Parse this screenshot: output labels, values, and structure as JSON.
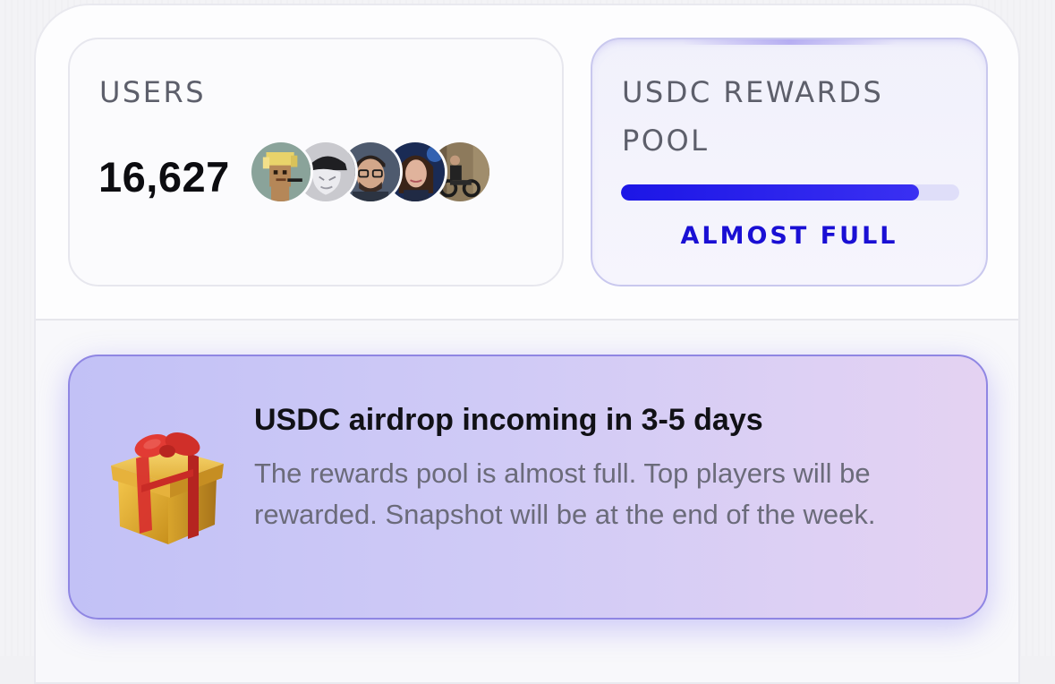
{
  "stats": {
    "users": {
      "label": "USERS",
      "count": "16,627",
      "avatars": [
        {
          "name": "pixel-punk-avatar"
        },
        {
          "name": "mask-avatar"
        },
        {
          "name": "glasses-man-avatar"
        },
        {
          "name": "cyber-woman-avatar"
        },
        {
          "name": "motorbike-rider-avatar"
        }
      ]
    },
    "rewards_pool": {
      "label": "USDC REWARDS POOL",
      "fill_fraction": 0.88,
      "status": "ALMOST FULL"
    }
  },
  "airdrop_banner": {
    "icon": "gift-icon",
    "title": "USDC airdrop incoming in 3-5 days",
    "body": "The rewards pool is almost full. Top players will be rewarded. Snapshot will be at the end of the week."
  },
  "colors": {
    "accent": "#1c16e6",
    "status_text": "#1a0fd4",
    "banner_border": "#8f86e3"
  }
}
